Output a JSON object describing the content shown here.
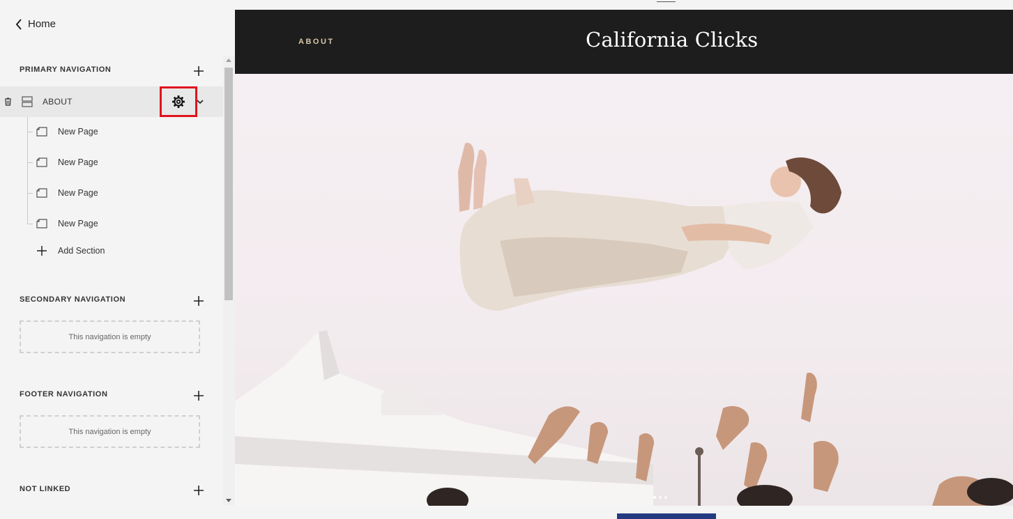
{
  "sidebar": {
    "back_label": "Home",
    "primary": {
      "title": "PRIMARY NAVIGATION",
      "folder": {
        "label": "ABOUT"
      },
      "pages": [
        {
          "label": "New Page"
        },
        {
          "label": "New Page"
        },
        {
          "label": "New Page"
        },
        {
          "label": "New Page"
        }
      ],
      "add_section_label": "Add Section"
    },
    "secondary": {
      "title": "SECONDARY NAVIGATION",
      "empty_text": "This navigation is empty"
    },
    "footer": {
      "title": "FOOTER NAVIGATION",
      "empty_text": "This navigation is empty"
    },
    "not_linked": {
      "title": "NOT LINKED"
    }
  },
  "preview": {
    "nav_item": "ABOUT",
    "site_title": "California Clicks",
    "accent_color": "#d9c6a7",
    "header_bg": "#1d1d1d",
    "highlight_color": "#e0131e"
  }
}
